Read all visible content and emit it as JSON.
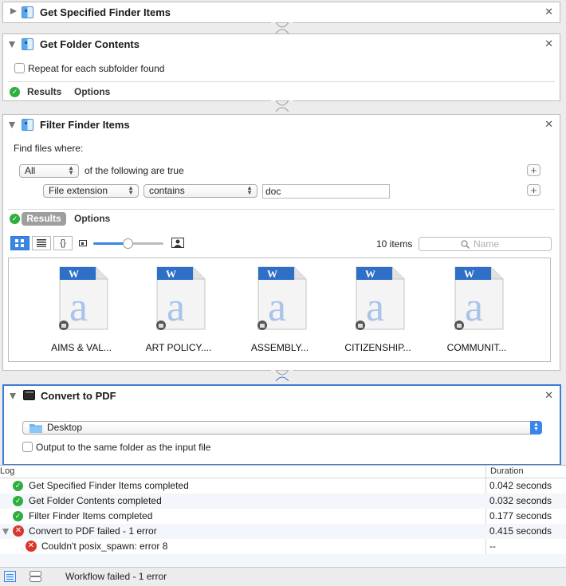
{
  "actions": [
    {
      "title": "Get Specified Finder Items",
      "expanded": false
    },
    {
      "title": "Get Folder Contents",
      "expanded": true,
      "checkbox_label": "Repeat for each subfolder found",
      "checked": false,
      "tabs": [
        "Results",
        "Options"
      ]
    },
    {
      "title": "Filter Finder Items",
      "expanded": true,
      "find_label": "Find files where:",
      "match_popup": "All",
      "match_suffix": "of the following are true",
      "criteria": {
        "field": "File extension",
        "operator": "contains",
        "value": "doc"
      },
      "tabs": [
        "Results",
        "Options"
      ],
      "item_count": "10 items",
      "search_placeholder": "Name",
      "files": [
        "AIMS & VAL...",
        "ART POLICY....",
        "ASSEMBLY...",
        "CITIZENSHIP...",
        "COMMUNIT..."
      ]
    },
    {
      "title": "Convert to PDF",
      "expanded": true,
      "folder_popup": "Desktop",
      "checkbox_label": "Output to the same folder as the input file",
      "checked": false
    }
  ],
  "log": {
    "col_log": "Log",
    "col_duration": "Duration",
    "rows": [
      {
        "status": "ok",
        "text": "Get Specified Finder Items completed",
        "duration": "0.042 seconds"
      },
      {
        "status": "ok",
        "text": "Get Folder Contents completed",
        "duration": "0.032 seconds"
      },
      {
        "status": "ok",
        "text": "Filter Finder Items completed",
        "duration": "0.177 seconds"
      },
      {
        "status": "error",
        "text": "Convert to PDF failed - 1 error",
        "duration": "0.415 seconds"
      },
      {
        "status": "error",
        "text": "Couldn't posix_spawn: error 8",
        "duration": "--"
      }
    ]
  },
  "status_bar": {
    "message": "Workflow failed - 1 error"
  },
  "colors": {
    "accent": "#3d7bd6",
    "success": "#2eae3f",
    "error": "#d9362c",
    "word_blue": "#2f6fc7"
  }
}
